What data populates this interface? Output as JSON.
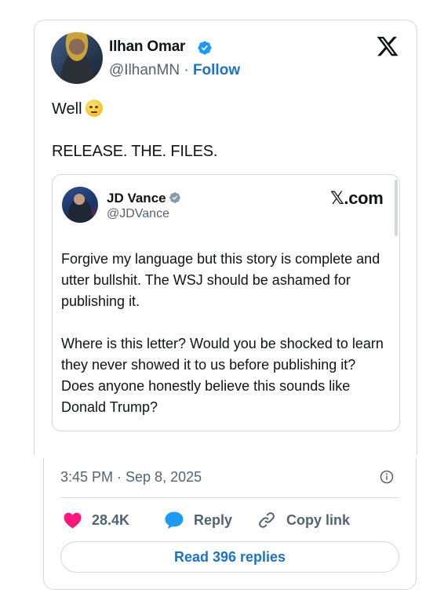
{
  "author": {
    "name": "Ilhan Omar",
    "handle": "@IlhanMN",
    "separator": "·",
    "follow_label": "Follow",
    "verified": true
  },
  "tweet": {
    "line1": "Well",
    "emoji": "face-with-rolling-eyes",
    "line2": "RELEASE. THE. FILES."
  },
  "quote": {
    "name": "JD Vance",
    "handle": "@JDVance",
    "verified": true,
    "brand": "𝕏.com",
    "paragraph1": "Forgive my language but this story is complete and utter bullshit. The WSJ should be ashamed for publishing it.",
    "paragraph2": "Where is this letter? Would you be shocked to learn they never showed it to us before publishing it? Does anyone honestly believe this sounds like Donald Trump?"
  },
  "meta": {
    "timestamp": "3:45 PM · Sep 8, 2025"
  },
  "actions": {
    "likes": "28.4K",
    "reply_label": "Reply",
    "copy_link_label": "Copy link",
    "read_replies_label": "Read 396 replies"
  },
  "colors": {
    "accent": "#1d9bf0",
    "link": "#1d73c2",
    "like": "#f91880",
    "muted": "#536471",
    "border": "#cfd9de"
  }
}
